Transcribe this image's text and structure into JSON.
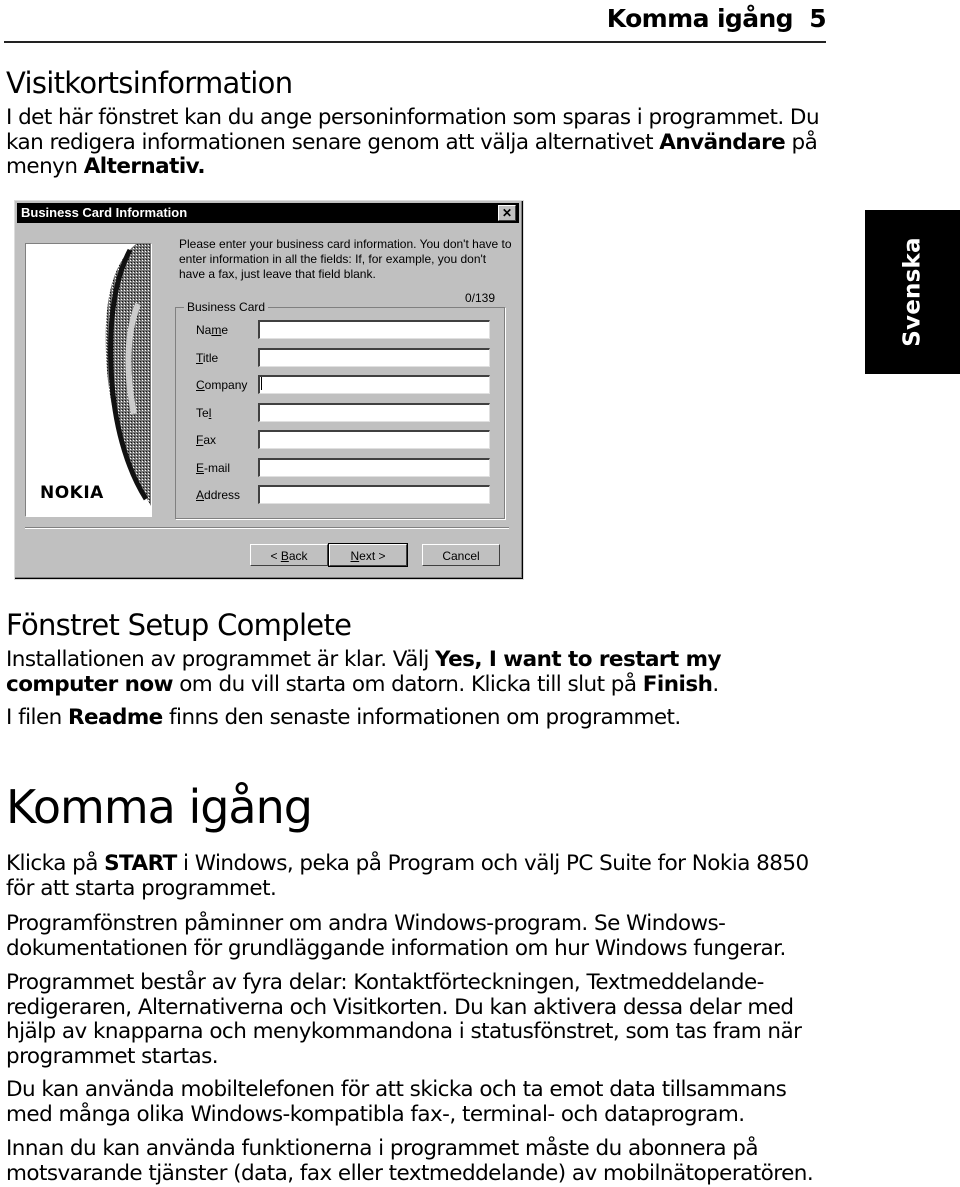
{
  "running_head": {
    "title": "Komma igång",
    "page_number": "5"
  },
  "side_tab": {
    "label": "Svenska"
  },
  "section1": {
    "heading": "Visitkortsinformation",
    "paragraph": [
      {
        "text": "I det här fönstret kan du ange personinformation som sparas i programmet. Du kan redigera informationen senare genom att välja alternativet "
      },
      {
        "text": "Användare",
        "bold": true
      },
      {
        "text": " på menyn "
      },
      {
        "text": "Alternativ.",
        "bold": true
      }
    ]
  },
  "dialog": {
    "title": "Business Card Information",
    "close_icon": "close-icon",
    "banner_logo": "NOKIA",
    "intro": "Please enter your business card information. You don't have to enter information in all the fields: If, for example, you don't have a fax, just leave that field blank.",
    "counter": "0/139",
    "group_label": "Business Card",
    "fields": [
      {
        "label_pre": "Na",
        "label_u": "m",
        "label_post": "e",
        "value": ""
      },
      {
        "label_pre": "",
        "label_u": "T",
        "label_post": "itle",
        "value": ""
      },
      {
        "label_pre": "",
        "label_u": "C",
        "label_post": "ompany",
        "value": "",
        "focused": true
      },
      {
        "label_pre": "Te",
        "label_u": "l",
        "label_post": "",
        "value": ""
      },
      {
        "label_pre": "",
        "label_u": "F",
        "label_post": "ax",
        "value": ""
      },
      {
        "label_pre": "",
        "label_u": "E",
        "label_post": "-mail",
        "value": ""
      },
      {
        "label_pre": "",
        "label_u": "A",
        "label_post": "ddress",
        "value": ""
      }
    ],
    "buttons": {
      "back": {
        "pre": "< ",
        "u": "B",
        "post": "ack"
      },
      "next": {
        "pre": "",
        "u": "N",
        "post": "ext >"
      },
      "cancel": {
        "label": "Cancel"
      }
    }
  },
  "section2": {
    "heading": "Fönstret Setup Complete",
    "paragraphs": [
      [
        {
          "text": "Installationen av programmet är klar. Välj "
        },
        {
          "text": "Yes, I want to restart my computer now",
          "bold": true
        },
        {
          "text": " om du vill starta om datorn. Klicka till slut på "
        },
        {
          "text": "Finish",
          "bold": true
        },
        {
          "text": "."
        }
      ],
      [
        {
          "text": "I filen "
        },
        {
          "text": "Readme",
          "bold": true
        },
        {
          "text": " finns den senaste informationen om programmet."
        }
      ]
    ]
  },
  "section3": {
    "heading": "Komma igång",
    "paragraphs": [
      [
        {
          "text": "Klicka på "
        },
        {
          "text": "START",
          "bold": true
        },
        {
          "text": " i Windows, peka på Program och välj PC Suite for Nokia 8850 för att starta programmet."
        }
      ],
      [
        {
          "text": "Programfönstren påminner om andra Windows-program. Se Windows-dokumentationen för grundläggande information om hur Windows fungerar."
        }
      ],
      [
        {
          "text": "Programmet består av fyra delar: Kontaktförteckningen, Textmeddelande-redigeraren, Alternativerna och Visitkorten. Du kan aktivera dessa delar med hjälp av knapparna och menykommandona i statusfönstret, som tas fram när programmet startas."
        }
      ],
      [
        {
          "text": "Du kan använda mobiltelefonen för att skicka och ta emot data tillsammans med många olika Windows-kompatibla fax-, terminal- och dataprogram."
        }
      ],
      [
        {
          "text": "Innan du kan använda funktionerna i programmet måste du abonnera på motsvarande tjänster (data, fax eller textmeddelande) av mobilnätoperatören."
        }
      ]
    ]
  }
}
